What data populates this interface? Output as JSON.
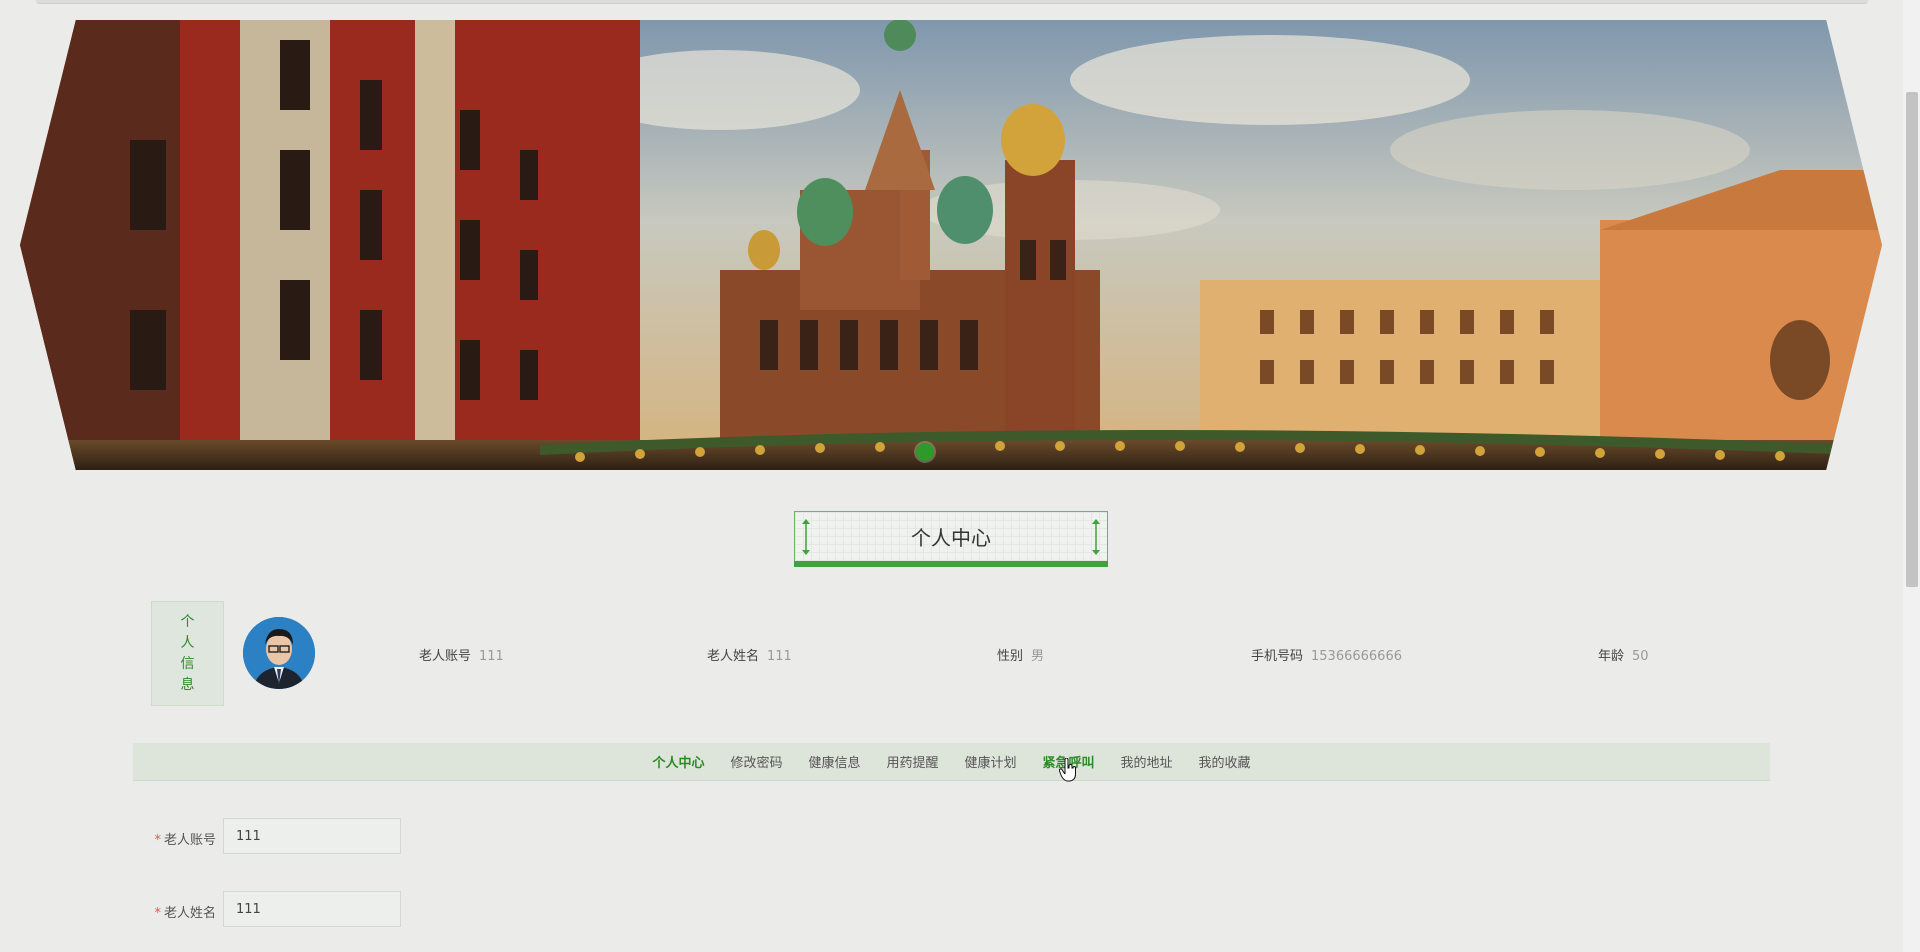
{
  "banner": {
    "active_slide": 1,
    "slide_count": 1
  },
  "section_title": "个人中心",
  "profile": {
    "side_label": [
      "个",
      "人",
      "信",
      "息"
    ],
    "fields": [
      {
        "key": "老人账号",
        "value": "111"
      },
      {
        "key": "老人姓名",
        "value": "111"
      },
      {
        "key": "性别",
        "value": "男"
      },
      {
        "key": "手机号码",
        "value": "15366666666"
      },
      {
        "key": "年龄",
        "value": "50"
      }
    ]
  },
  "tabs": [
    {
      "label": "个人中心",
      "state": "active"
    },
    {
      "label": "修改密码",
      "state": "normal"
    },
    {
      "label": "健康信息",
      "state": "normal"
    },
    {
      "label": "用药提醒",
      "state": "normal"
    },
    {
      "label": "健康计划",
      "state": "normal"
    },
    {
      "label": "紧急呼叫",
      "state": "hover"
    },
    {
      "label": "我的地址",
      "state": "normal"
    },
    {
      "label": "我的收藏",
      "state": "normal"
    }
  ],
  "form": {
    "required_mark": "*",
    "fields": [
      {
        "label": "老人账号",
        "value": "111"
      },
      {
        "label": "老人姓名",
        "value": "111"
      }
    ]
  },
  "colors": {
    "accent": "#2e9a2a",
    "tab_bar": "#dde4da",
    "page_bg": "#ebebe9"
  }
}
